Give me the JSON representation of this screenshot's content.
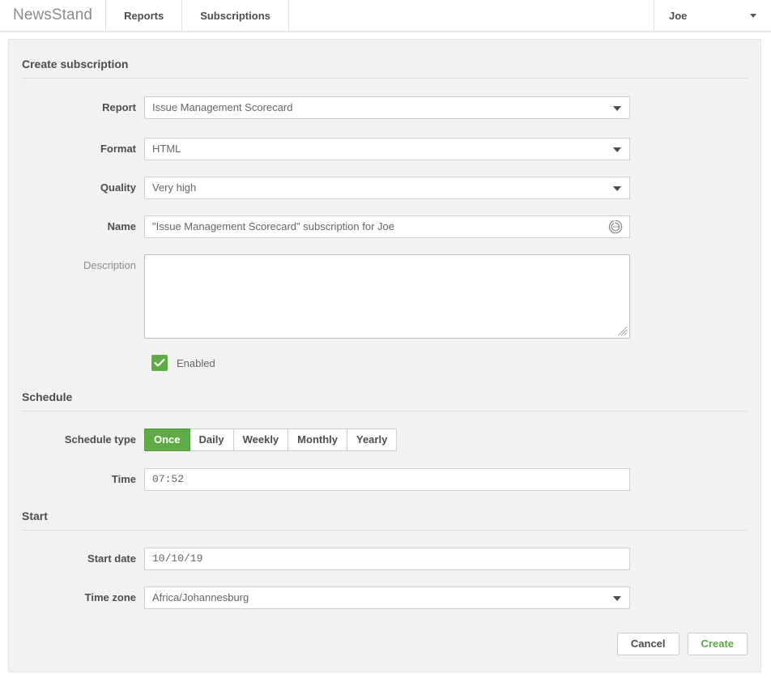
{
  "navbar": {
    "brand": "NewsStand",
    "tabs": [
      {
        "label": "Reports"
      },
      {
        "label": "Subscriptions"
      }
    ],
    "user": {
      "name": "Joe",
      "caret_icon": "chevron-down-icon"
    }
  },
  "sections": {
    "create": {
      "title": "Create subscription",
      "fields": {
        "report": {
          "label": "Report",
          "value": "Issue Management Scorecard",
          "icon": "chevron-down-icon"
        },
        "format": {
          "label": "Format",
          "value": "HTML",
          "icon": "chevron-down-icon"
        },
        "quality": {
          "label": "Quality",
          "value": "Very high",
          "icon": "chevron-down-icon"
        },
        "name": {
          "label": "Name",
          "value": "\"Issue Management Scorecard\" subscription for Joe",
          "placeholder": "",
          "icon": "regenerate-icon"
        },
        "description": {
          "label": "Description",
          "value": "",
          "placeholder": ""
        },
        "enabled": {
          "label": "Enabled",
          "checked": true,
          "icon": "check-icon"
        }
      }
    },
    "schedule": {
      "title": "Schedule",
      "fields": {
        "schedule_type": {
          "label": "Schedule type",
          "selected": "Once",
          "options": [
            "Once",
            "Daily",
            "Weekly",
            "Monthly",
            "Yearly"
          ]
        },
        "time": {
          "label": "Time",
          "value": "07:52"
        }
      }
    },
    "start": {
      "title": "Start",
      "fields": {
        "start_date": {
          "label": "Start date",
          "value": "10/10/19"
        },
        "time_zone": {
          "label": "Time zone",
          "value": "Africa/Johannesburg",
          "icon": "chevron-down-icon"
        }
      }
    }
  },
  "footer": {
    "cancel_label": "Cancel",
    "create_label": "Create"
  },
  "colors": {
    "accent_green": "#61ab46",
    "create_text_green": "#5aa54a",
    "card_bg": "#f2f2f2",
    "border": "#cccccc"
  }
}
